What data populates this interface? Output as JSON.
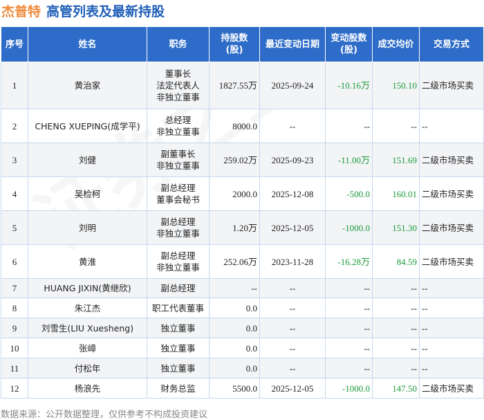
{
  "header": {
    "company": "杰普特",
    "title": "高管列表及最新持股"
  },
  "columns": [
    "序号",
    "姓名",
    "职务",
    "持股数\n(股)",
    "最近变动日期",
    "变动股数\n(股)",
    "成交均价",
    "交易方式"
  ],
  "rows": [
    {
      "no": "1",
      "name": "黄治家",
      "role": "董事长\n法定代表人\n非独立董事",
      "shares": "1827.55万",
      "date": "2025-09-24",
      "change": "-10.16万",
      "price": "150.10",
      "method": "二级市场买卖"
    },
    {
      "no": "2",
      "name": "CHENG XUEPING(成学平)",
      "role": "总经理\n非独立董事",
      "shares": "8000.0",
      "date": "--",
      "change": "--",
      "price": "--",
      "method": "--"
    },
    {
      "no": "3",
      "name": "刘健",
      "role": "副董事长\n非独立董事",
      "shares": "259.02万",
      "date": "2025-09-23",
      "change": "-11.00万",
      "price": "151.69",
      "method": "二级市场买卖"
    },
    {
      "no": "4",
      "name": "吴检柯",
      "role": "副总经理\n董事会秘书",
      "shares": "2000.0",
      "date": "2025-12-08",
      "change": "-500.0",
      "price": "160.01",
      "method": "二级市场买卖"
    },
    {
      "no": "5",
      "name": "刘明",
      "role": "副总经理\n非独立董事",
      "shares": "1.20万",
      "date": "2025-12-05",
      "change": "-1000.0",
      "price": "151.30",
      "method": "二级市场买卖"
    },
    {
      "no": "6",
      "name": "黄淮",
      "role": "副总经理\n非独立董事",
      "shares": "252.06万",
      "date": "2023-11-28",
      "change": "-16.28万",
      "price": "84.59",
      "method": "二级市场买卖"
    },
    {
      "no": "7",
      "name": "HUANG JIXIN(黄继欣)",
      "role": "副总经理",
      "shares": "--",
      "date": "--",
      "change": "--",
      "price": "--",
      "method": "--"
    },
    {
      "no": "8",
      "name": "朱江杰",
      "role": "职工代表董事",
      "shares": "0.0",
      "date": "--",
      "change": "--",
      "price": "--",
      "method": "--"
    },
    {
      "no": "9",
      "name": "刘雪生(LIU Xuesheng)",
      "role": "独立董事",
      "shares": "0.0",
      "date": "--",
      "change": "--",
      "price": "--",
      "method": "--"
    },
    {
      "no": "10",
      "name": "张嶂",
      "role": "独立董事",
      "shares": "0.0",
      "date": "--",
      "change": "--",
      "price": "--",
      "method": "--"
    },
    {
      "no": "11",
      "name": "付松年",
      "role": "独立董事",
      "shares": "0.0",
      "date": "--",
      "change": "--",
      "price": "--",
      "method": "--"
    },
    {
      "no": "12",
      "name": "杨浪先",
      "role": "财务总监",
      "shares": "5500.0",
      "date": "2025-12-05",
      "change": "-1000.0",
      "price": "147.50",
      "method": "二级市场买卖"
    }
  ],
  "footer": "数据来源：公开数据整理，仅供参考不构成投资建议",
  "colors": {
    "header_bg": "#2d6cc8",
    "company": "#f08a3c",
    "title": "#1f5fb8",
    "positive_green": "#1a9a3a"
  }
}
